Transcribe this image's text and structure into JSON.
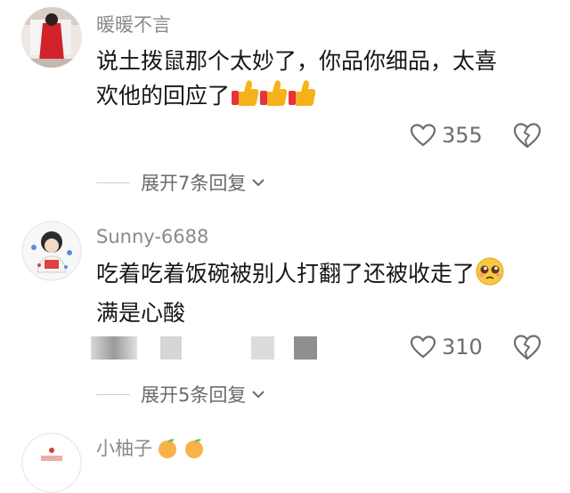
{
  "comments": [
    {
      "username": "暖暖不言",
      "text_line1": "说土拨鼠那个太妙了，你品你细品，太喜",
      "text_line2": "欢他的回应了",
      "like_count": "355",
      "replies_label": "展开7条回复",
      "emoji": "thumbs-up-icon"
    },
    {
      "username": "Sunny-6688",
      "text_line1": "吃着吃着饭碗被别人打翻了还被收走了",
      "text_line2": "满是心酸",
      "like_count": "310",
      "replies_label": "展开5条回复",
      "emoji": "pleading-face-icon"
    },
    {
      "username": "小柚子",
      "emoji": "peach-icon"
    }
  ],
  "colors": {
    "text": "#161616",
    "username": "#8a8a8a",
    "meta": "#6b6b6b"
  }
}
